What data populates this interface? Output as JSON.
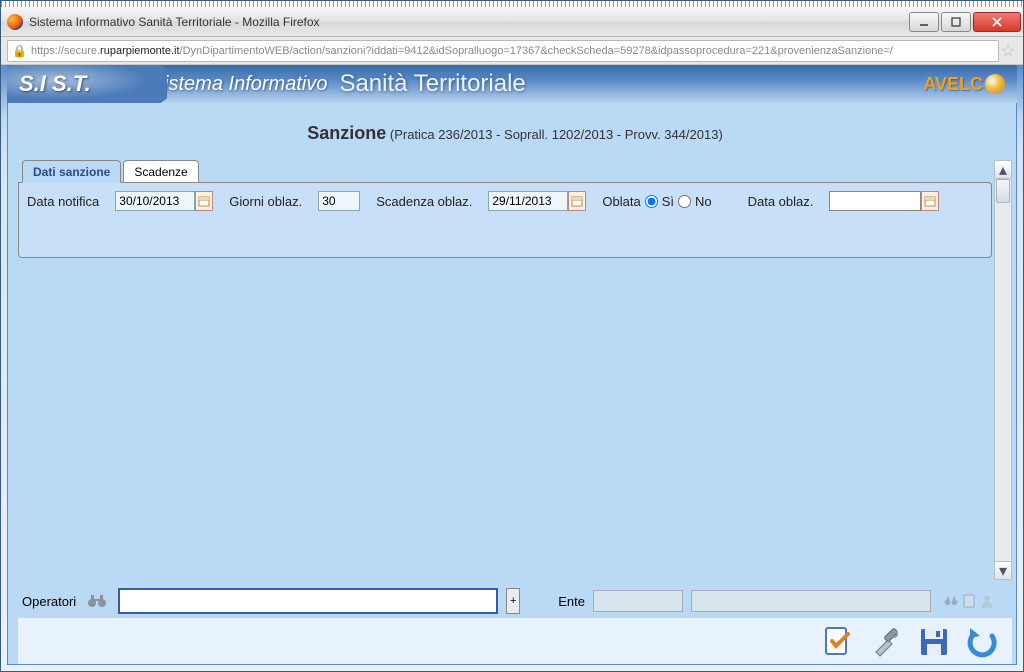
{
  "window": {
    "title": "Sistema Informativo Sanità Territoriale - Mozilla Firefox",
    "url_prefix": "https://secure.",
    "url_host": "ruparpiemonte.it",
    "url_path": "/DynDipartimentoWEB/action/sanzioni?iddati=9412&idSopralluogo=17367&checkScheda=59278&idpassoprocedura=221&provenienzaSanzione=/"
  },
  "header": {
    "logo_short": "S.I S.T.",
    "logo_middle": "Sistema Informativo",
    "logo_main": "Sanità Territoriale",
    "brand": "AVELC"
  },
  "page": {
    "title_main": "Sanzione",
    "title_detail": "(Pratica 236/2013 - Soprall. 1202/2013 - Provv. 344/2013)"
  },
  "tabs": {
    "active": "Dati sanzione",
    "inactive": "Scadenze"
  },
  "form": {
    "data_notifica_label": "Data notifica",
    "data_notifica_value": "30/10/2013",
    "giorni_label": "Giorni oblaz.",
    "giorni_value": "30",
    "scadenza_label": "Scadenza oblaz.",
    "scadenza_value": "29/11/2013",
    "oblata_label": "Oblata",
    "oblata_si": "Sì",
    "oblata_no": "No",
    "data_oblaz_label": "Data oblaz.",
    "data_oblaz_value": ""
  },
  "footer": {
    "operatori_label": "Operatori",
    "operatori_value": "",
    "plus": "+",
    "ente_label": "Ente",
    "ente_value1": "",
    "ente_value2": ""
  }
}
